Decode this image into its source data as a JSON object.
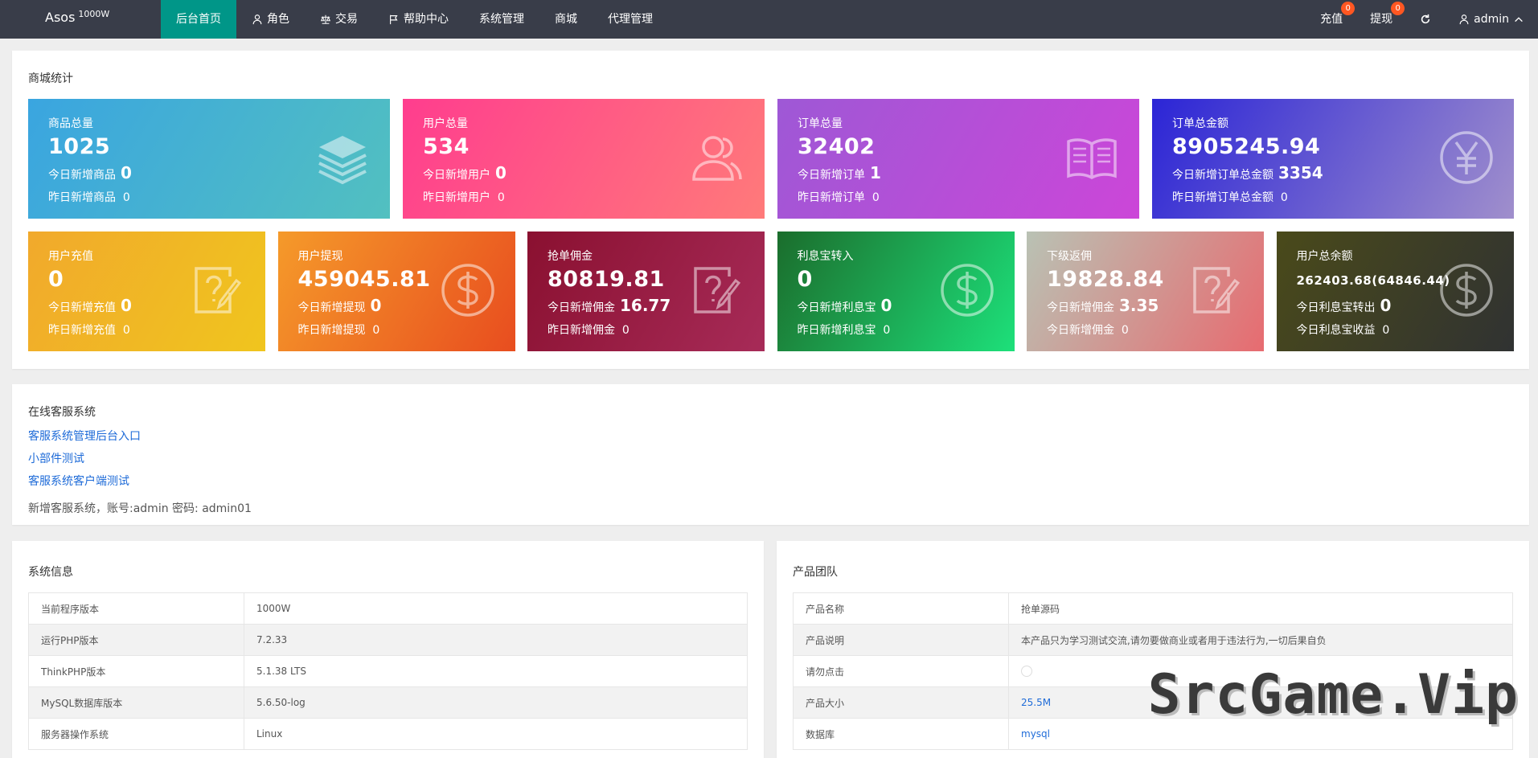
{
  "brand": {
    "name": "Asos",
    "sub": "1000W"
  },
  "nav": [
    {
      "label": "后台首页",
      "icon": ""
    },
    {
      "label": "角色",
      "icon": "user-icon"
    },
    {
      "label": "交易",
      "icon": "scale-icon"
    },
    {
      "label": "帮助中心",
      "icon": "flag-icon"
    },
    {
      "label": "系统管理",
      "icon": ""
    },
    {
      "label": "商城",
      "icon": ""
    },
    {
      "label": "代理管理",
      "icon": ""
    }
  ],
  "right_nav": {
    "recharge": {
      "label": "充值",
      "badge": "0"
    },
    "withdraw": {
      "label": "提现",
      "badge": "0"
    },
    "refresh_icon": "refresh-icon",
    "user": {
      "label": "admin",
      "icon": "user-icon"
    }
  },
  "stats": {
    "title": "商城统计",
    "row1": [
      {
        "title": "商品总量",
        "value": "1025",
        "today_label": "今日新增商品",
        "today_value": "0",
        "yest_label": "昨日新增商品",
        "yest_value": "0",
        "icon": "layers-icon",
        "colors": [
          "#3aa5e0",
          "#52c0c0"
        ]
      },
      {
        "title": "用户总量",
        "value": "534",
        "today_label": "今日新增用户",
        "today_value": "0",
        "yest_label": "昨日新增用户",
        "yest_value": "0",
        "icon": "users-icon",
        "colors": [
          "#ff3d8e",
          "#ff7a7a"
        ]
      },
      {
        "title": "订单总量",
        "value": "32402",
        "today_label": "今日新增订单",
        "today_value": "1",
        "yest_label": "昨日新增订单",
        "yest_value": "0",
        "icon": "book-icon",
        "colors": [
          "#9e58d6",
          "#cc46d8"
        ]
      },
      {
        "title": "订单总金额",
        "value": "8905245.94",
        "today_label": "今日新增订单总金额",
        "today_value": "3354",
        "yest_label": "昨日新增订单总金额",
        "yest_value": "0",
        "icon": "yen-icon",
        "colors": [
          "#2b25d6",
          "#a08fcc"
        ]
      }
    ],
    "row2": [
      {
        "title": "用户充值",
        "value": "0",
        "today_label": "今日新增充值",
        "today_value": "0",
        "yest_label": "昨日新增充值",
        "yest_value": "0",
        "icon": "note-icon",
        "colors": [
          "#f1a92c",
          "#f0c51e"
        ]
      },
      {
        "title": "用户提现",
        "value": "459045.81",
        "today_label": "今日新增提现",
        "today_value": "0",
        "yest_label": "昨日新增提现",
        "yest_value": "0",
        "icon": "dollar-icon",
        "colors": [
          "#f59a2a",
          "#e84d1f"
        ]
      },
      {
        "title": "抢单佣金",
        "value": "80819.81",
        "today_label": "今日新增佣金",
        "today_value": "16.77",
        "yest_label": "昨日新增佣金",
        "yest_value": "0",
        "icon": "note-icon",
        "colors": [
          "#8a1030",
          "#a72b58"
        ]
      },
      {
        "title": "利息宝转入",
        "value": "0",
        "today_label": "今日新增利息宝",
        "today_value": "0",
        "yest_label": "昨日新增利息宝",
        "yest_value": "0",
        "icon": "dollar-icon",
        "colors": [
          "#1b6d2c",
          "#1de07a"
        ]
      },
      {
        "title": "下级返佣",
        "value": "19828.84",
        "today_label": "今日新增佣金",
        "today_value": "3.35",
        "yest_label": "今日新增佣金",
        "yest_value": "0",
        "icon": "note-icon",
        "colors": [
          "#b9c2b4",
          "#e76b70"
        ]
      },
      {
        "title": "用户总余额",
        "value": "262403.68(64846.44)",
        "today_label": "今日利息宝转出",
        "today_value": "0",
        "yest_label": "今日利息宝收益",
        "yest_value": "0",
        "icon": "dollar-icon",
        "colors": [
          "#4a4a1a",
          "#303232"
        ]
      }
    ]
  },
  "service": {
    "title": "在线客服系统",
    "links": [
      "客服系统管理后台入口",
      "小部件测试",
      "客服系统客户端测试"
    ],
    "note": "新增客服系统，账号:admin 密码: admin01"
  },
  "sysinfo": {
    "title": "系统信息",
    "rows": [
      [
        "当前程序版本",
        "1000W"
      ],
      [
        "运行PHP版本",
        "7.2.33"
      ],
      [
        "ThinkPHP版本",
        "5.1.38 LTS"
      ],
      [
        "MySQL数据库版本",
        "5.6.50-log"
      ],
      [
        "服务器操作系统",
        "Linux"
      ]
    ]
  },
  "team": {
    "title": "产品团队",
    "rows": [
      [
        "产品名称",
        "抢单源码"
      ],
      [
        "产品说明",
        "本产品只为学习测试交流,请勿要做商业或者用于违法行为,一切后果自负"
      ],
      [
        "请勿点击",
        ""
      ],
      [
        "产品大小",
        "25.5M"
      ],
      [
        "数据库",
        "mysql"
      ]
    ]
  },
  "watermark": "SrcGame.Vip"
}
